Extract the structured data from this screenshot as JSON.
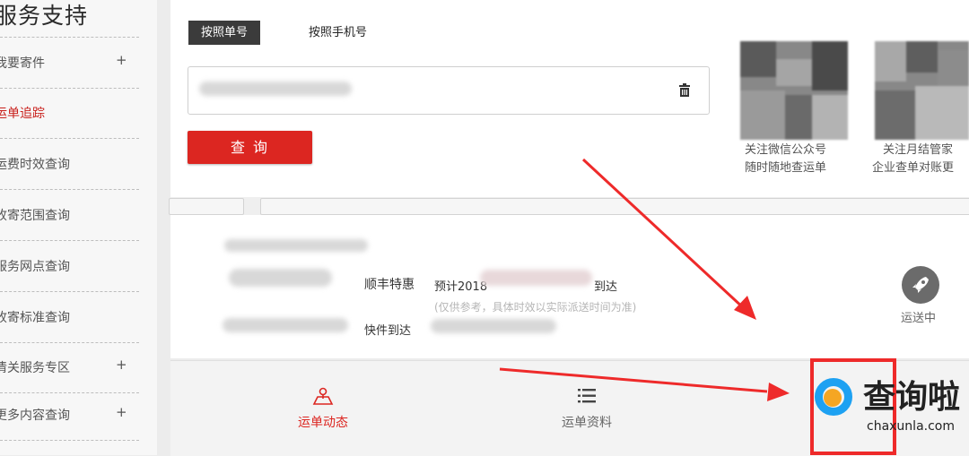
{
  "sidebar": {
    "title": "服务支持",
    "items": [
      {
        "label": "我要寄件",
        "plus": "+",
        "active": false
      },
      {
        "label": "运单追踪",
        "plus": "",
        "active": true
      },
      {
        "label": "运费时效查询",
        "plus": "",
        "active": false
      },
      {
        "label": "收寄范围查询",
        "plus": "",
        "active": false
      },
      {
        "label": "服务网点查询",
        "plus": "",
        "active": false
      },
      {
        "label": "收寄标准查询",
        "plus": "",
        "active": false
      },
      {
        "label": "清关服务专区",
        "plus": "+",
        "active": false
      },
      {
        "label": "更多内容查询",
        "plus": "+",
        "active": false
      }
    ]
  },
  "search": {
    "tab_waybill": "按照单号",
    "tab_phone": "按照手机号",
    "query_button": "查 询"
  },
  "qr": {
    "left_line1": "关注微信公众号",
    "left_line2": "随时随地查运单",
    "right_line1": "关注月结管家",
    "right_line2": "企业查单对账更"
  },
  "result": {
    "service": "顺丰特惠",
    "estimate_prefix": "预计2018",
    "estimate_suffix": "到达",
    "note": "(仅供参考，具体时效以实际派送时间为准)",
    "arrival": "快件到达",
    "status": "运送中"
  },
  "bottom_tabs": {
    "dynamic": "运单动态",
    "info": "运单资料"
  },
  "watermark": {
    "name": "查询啦",
    "domain": "chaxunla.com"
  },
  "colors": {
    "brand_red": "#dc2621",
    "annotation_red": "#ee2a2a"
  }
}
